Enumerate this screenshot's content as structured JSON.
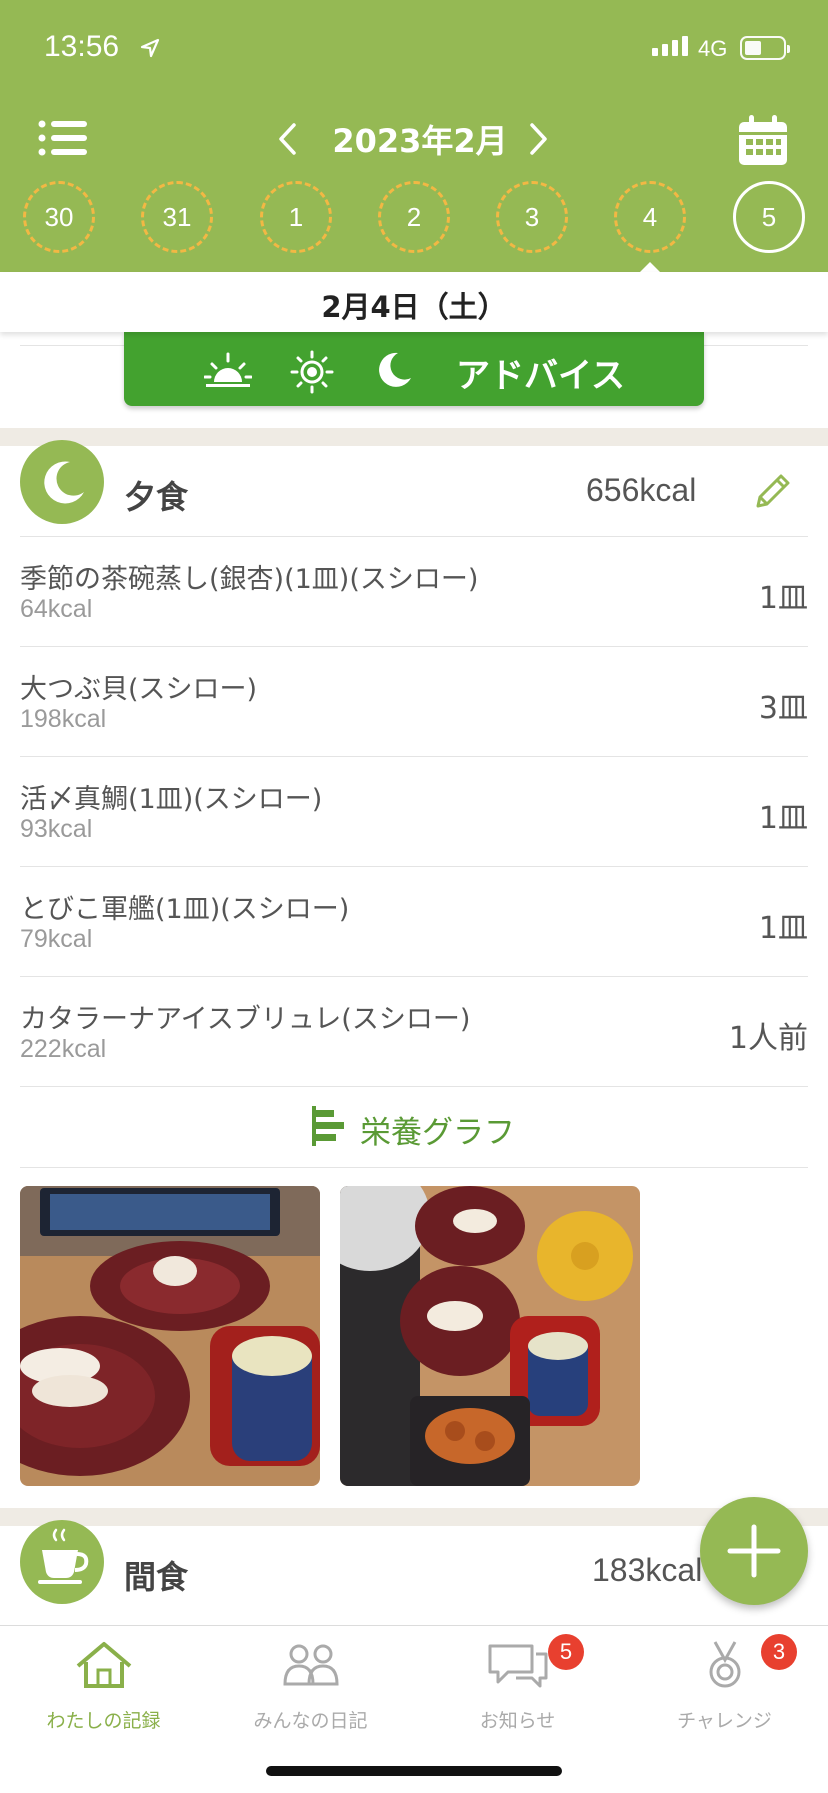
{
  "status": {
    "time": "13:56",
    "network": "4G"
  },
  "header": {
    "month": "2023年2月",
    "days": [
      {
        "label": "30"
      },
      {
        "label": "31"
      },
      {
        "label": "1"
      },
      {
        "label": "2"
      },
      {
        "label": "3"
      },
      {
        "label": "4"
      },
      {
        "label": "5"
      }
    ],
    "selected_date": "2月4日（土）"
  },
  "advice": {
    "label": "アドバイス"
  },
  "dinner": {
    "title": "夕食",
    "kcal": "656kcal",
    "items": [
      {
        "name": "季節の茶碗蒸し(銀杏)(1皿)(スシロー)",
        "kcal": "64kcal",
        "qty": "1皿"
      },
      {
        "name": "大つぶ貝(スシロー)",
        "kcal": "198kcal",
        "qty": "3皿"
      },
      {
        "name": "活〆真鯛(1皿)(スシロー)",
        "kcal": "93kcal",
        "qty": "1皿"
      },
      {
        "name": "とびこ軍艦(1皿)(スシロー)",
        "kcal": "79kcal",
        "qty": "1皿"
      },
      {
        "name": "カタラーナアイスブリュレ(スシロー)",
        "kcal": "222kcal",
        "qty": "1人前"
      }
    ],
    "graph_label": "栄養グラフ"
  },
  "snack": {
    "title": "間食",
    "kcal": "183kcal"
  },
  "tabs": [
    {
      "label": "わたしの記録"
    },
    {
      "label": "みんなの日記"
    },
    {
      "label": "お知らせ",
      "badge": "5"
    },
    {
      "label": "チャレンジ",
      "badge": "3"
    }
  ],
  "colors": {
    "header": "#95b954",
    "advice": "#43a22f",
    "accent_ring": "#f2b844",
    "badge": "#e8402f"
  }
}
